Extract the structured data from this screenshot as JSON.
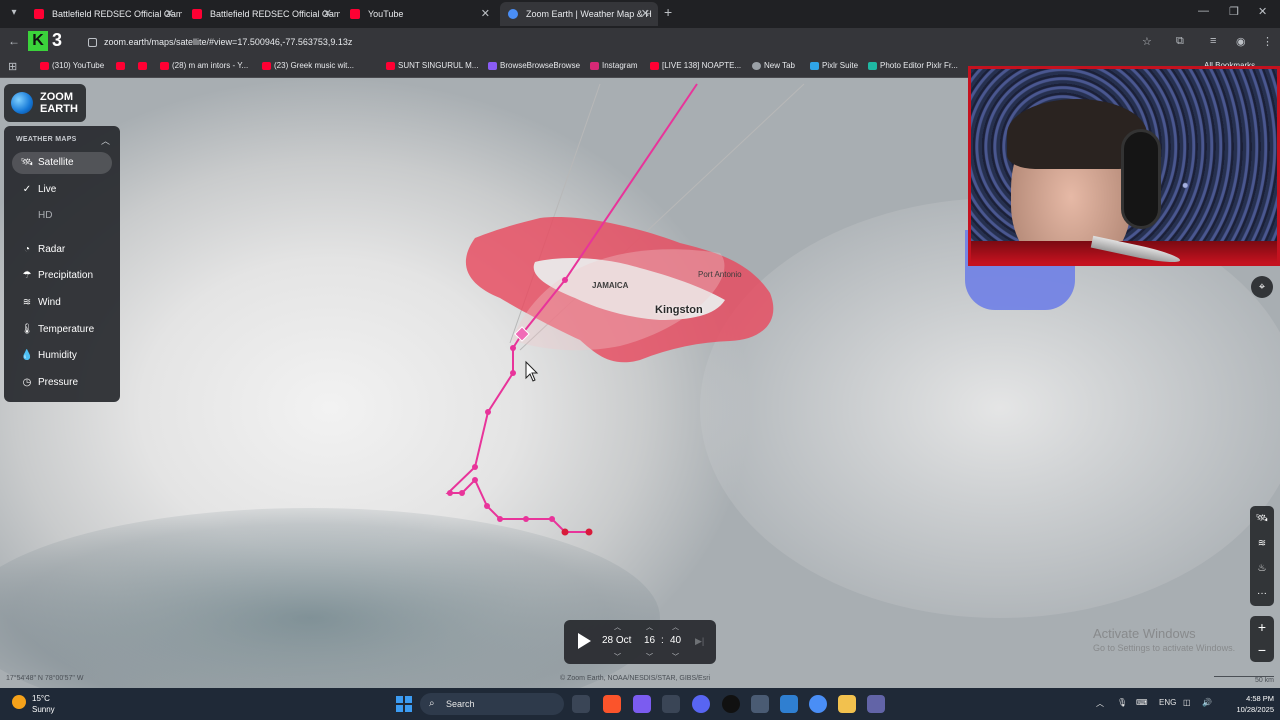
{
  "browser": {
    "tabs": [
      {
        "title": "Battlefield REDSEC Official Gam"
      },
      {
        "title": "Battlefield REDSEC Official Gam"
      },
      {
        "title": "YouTube"
      },
      {
        "title": "Zoom Earth | Weather Map & H",
        "active": true
      }
    ],
    "url": "zoom.earth/maps/satellite/#view=17.500946,-77.563753,9.13z",
    "k3_label": "3",
    "bookmarks": [
      "(310) YouTube",
      "(28) m am intors - Y...",
      "(23) Greek music wit...",
      "SUNT SINGURUL M...",
      "BrowseBrowseBrowse",
      "Instagram",
      "[LIVE 138] NOAPTE...",
      "New Tab",
      "Pixlr Suite",
      "Photo Editor Pixlr Fr...",
      "All Bookmarks"
    ]
  },
  "app": {
    "logo_line1": "ZOOM",
    "logo_line2": "EARTH",
    "panel_header": "WEATHER MAPS",
    "layers": [
      {
        "label": "Satellite",
        "icon": "satellite-icon",
        "selected": true
      },
      {
        "label": "Live",
        "icon": "check-icon"
      },
      {
        "label": "HD",
        "icon": ""
      },
      {
        "label": "Radar",
        "icon": "radar-icon"
      },
      {
        "label": "Precipitation",
        "icon": "precipitation-icon"
      },
      {
        "label": "Wind",
        "icon": "wind-icon"
      },
      {
        "label": "Temperature",
        "icon": "thermometer-icon"
      },
      {
        "label": "Humidity",
        "icon": "humidity-icon"
      },
      {
        "label": "Pressure",
        "icon": "pressure-icon"
      }
    ],
    "map_labels": {
      "country": "JAMAICA",
      "city": "Kingston",
      "town": "Port Antonio"
    },
    "timebar": {
      "date": "28 Oct",
      "hour": "16",
      "minute": "40",
      "separator": ":"
    },
    "coords": "17°54'48\" N  78°00'57\" W",
    "attribution": "© Zoom Earth, NOAA/NESDIS/STAR, GIBS/Esri",
    "scale": "50 km",
    "watermark1": "Activate Windows",
    "watermark2": "Go to Settings to activate Windows."
  },
  "taskbar": {
    "temp": "15°C",
    "condition": "Sunny",
    "search_placeholder": "Search",
    "lang": "ENG",
    "time": "4:58 PM",
    "date": "10/28/2025"
  },
  "colors": {
    "track": "#e8349a",
    "cone": "#e84a5f",
    "accent": "#4a8ef5"
  }
}
